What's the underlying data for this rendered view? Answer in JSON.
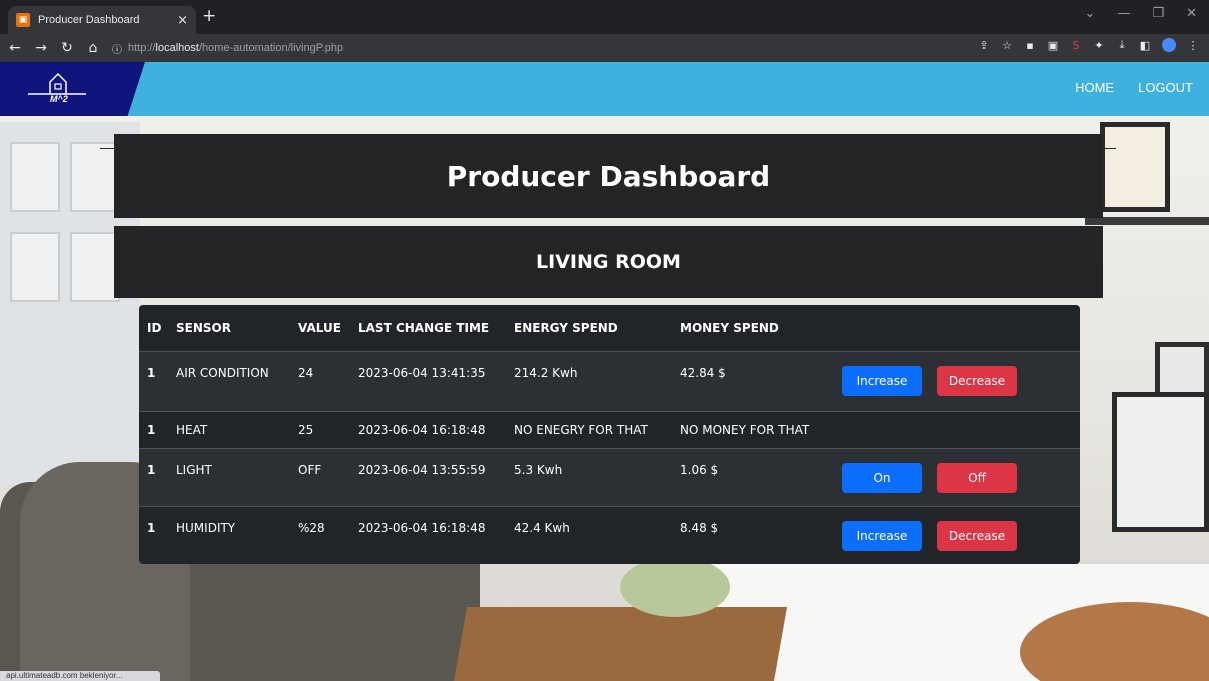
{
  "browser": {
    "tab_title": "Producer Dashboard",
    "tab_close": "×",
    "new_tab": "+",
    "url_prefix": "http://",
    "url_host": "localhost",
    "url_path": "/home-automation/livingP.php",
    "status_text": "api.ultimateadb.com bekleniyor..."
  },
  "site": {
    "brand_text": "M^2",
    "nav": {
      "home": "HOME",
      "logout": "LOGOUT"
    }
  },
  "dashboard": {
    "title": "Producer Dashboard",
    "room": "LIVING ROOM"
  },
  "table": {
    "headers": [
      "ID",
      "SENSOR",
      "VALUE",
      "LAST CHANGE TIME",
      "ENERGY SPEND",
      "MONEY SPEND"
    ],
    "rows": [
      {
        "id": "1",
        "sensor": "AIR CONDITION",
        "value": "24",
        "time": "2023-06-04 13:41:35",
        "energy": "214.2 Kwh",
        "money": "42.84 $",
        "btn1": "Increase",
        "btn2": "Decrease"
      },
      {
        "id": "1",
        "sensor": "HEAT",
        "value": "25",
        "time": "2023-06-04 16:18:48",
        "energy": "NO ENEGRY FOR THAT",
        "money": "NO MONEY FOR THAT"
      },
      {
        "id": "1",
        "sensor": "LIGHT",
        "value": "OFF",
        "time": "2023-06-04 13:55:59",
        "energy": "5.3 Kwh",
        "money": "1.06 $",
        "btn1": "On",
        "btn2": "Off"
      },
      {
        "id": "1",
        "sensor": "HUMIDITY",
        "value": "%28",
        "time": "2023-06-04 16:18:48",
        "energy": "42.4 Kwh",
        "money": "8.48 $",
        "btn1": "Increase",
        "btn2": "Decrease"
      }
    ]
  },
  "colors": {
    "navbar": "#3fb1de",
    "brand_bg": "#10157e",
    "panel_bg": "#232426",
    "btn_primary": "#0d6efd",
    "btn_danger": "#dc3545"
  }
}
